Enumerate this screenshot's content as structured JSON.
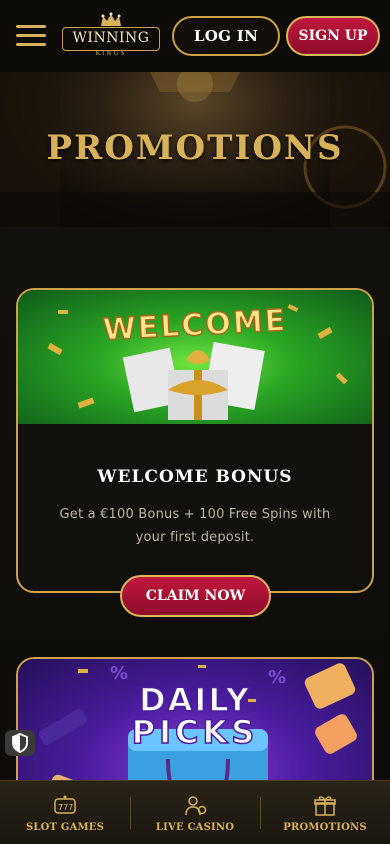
{
  "header": {
    "logo_text": "WINNING",
    "logo_sub": "KINGS",
    "login_label": "LOG IN",
    "signup_label": "SIGN UP"
  },
  "hero": {
    "title": "PROMOTIONS"
  },
  "promotions": [
    {
      "banner_text": "WELCOME",
      "title": "WELCOME BONUS",
      "description": "Get a €100 Bonus + 100 Free Spins with your first deposit.",
      "cta_label": "CLAIM NOW"
    },
    {
      "banner_text_1": "DAILY",
      "banner_text_2": "PICKS"
    }
  ],
  "bottom_nav": [
    {
      "label": "SLOT GAMES",
      "icon": "slot-machine-icon"
    },
    {
      "label": "LIVE CASINO",
      "icon": "dealer-icon"
    },
    {
      "label": "PROMOTIONS",
      "icon": "gift-icon"
    }
  ],
  "colors": {
    "gold": "#c9a24a",
    "gold_text": "#d8b25a",
    "red_button": "#c2173e",
    "background": "#0b0907"
  }
}
